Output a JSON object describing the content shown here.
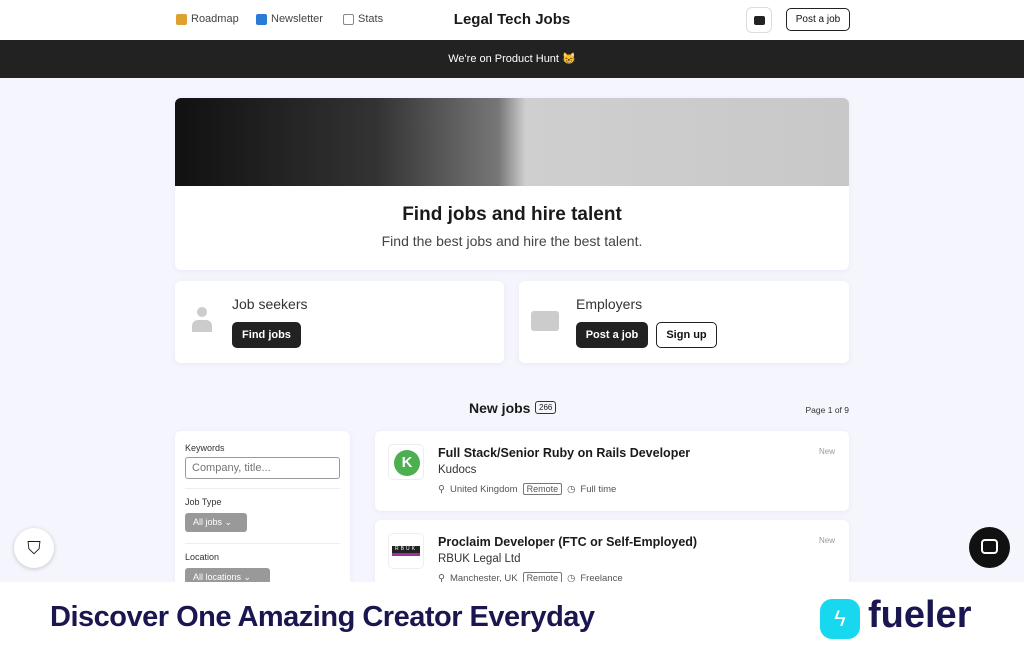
{
  "header": {
    "nav": [
      {
        "label": "Roadmap",
        "icon": "roadmap-icon",
        "color": "#e0a030"
      },
      {
        "label": "Newsletter",
        "icon": "newsletter-icon",
        "color": "#2a7ad8"
      },
      {
        "label": "Stats",
        "icon": "chart-icon",
        "color": "#d84040"
      }
    ],
    "title": "Legal Tech Jobs",
    "post_job": "Post a job"
  },
  "banner": {
    "text": "We're on Product Hunt 😸"
  },
  "hero": {
    "title": "Find jobs and hire talent",
    "subtitle": "Find the best jobs and hire the best talent."
  },
  "seekers": {
    "title": "Job seekers",
    "button": "Find jobs"
  },
  "employers": {
    "title": "Employers",
    "post": "Post a job",
    "signup": "Sign up"
  },
  "jobs": {
    "heading": "New jobs",
    "count": "266",
    "page": "Page 1 of 9",
    "items": [
      {
        "title": "Full Stack/Senior Ruby on Rails Developer",
        "company": "Kudocs",
        "location": "United Kingdom",
        "tag": "Remote",
        "type": "Full time",
        "badge": "New",
        "logo": "K"
      },
      {
        "title": "Proclaim Developer (FTC or Self-Employed)",
        "company": "RBUK Legal Ltd",
        "location": "Manchester, UK",
        "tag": "Remote",
        "type": "Freelance",
        "badge": "New",
        "logo": "RBUK"
      }
    ]
  },
  "filters": {
    "keywords_label": "Keywords",
    "keywords_placeholder": "Company, title...",
    "jobtype_label": "Job Type",
    "jobtype_value": "All jobs",
    "location_label": "Location",
    "location_value": "All locations"
  },
  "footer": {
    "tagline": "Discover One Amazing Creator Everyday",
    "brand": "fueler",
    "brand_color": "#1a1650",
    "accent": "#18d8f0"
  }
}
